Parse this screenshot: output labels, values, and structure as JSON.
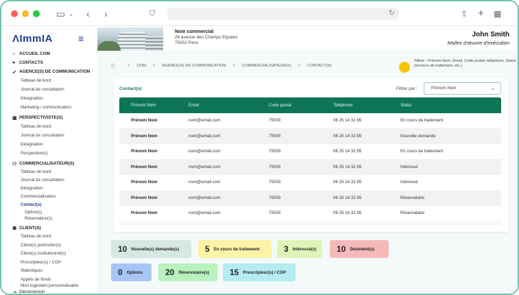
{
  "sidebar": {
    "logo": "ImmIA",
    "sections": [
      {
        "label": "ACCUEIL COM",
        "icon": "home-icon",
        "items": []
      },
      {
        "label": "CONTACTS",
        "icon": "user-icon",
        "items": []
      },
      {
        "label": "AGENCE(S) DE COMMUNICATION",
        "icon": "rocket-icon",
        "items": [
          "Tableau de bord",
          "Journal de consultation",
          "Désignation",
          "Marketing / communication"
        ]
      },
      {
        "label": "PERSPECTIVISTE(S)",
        "icon": "id-card-icon",
        "items": [
          "Tableau de bord",
          "Journal de consultation",
          "Désignation",
          "Perspective(s)"
        ]
      },
      {
        "label": "COMMERCIALISATEUR(S)",
        "icon": "users-icon",
        "items": [
          "Tableau de bord",
          "Journal de consultation",
          "Désignation",
          "Commercialisation",
          "Contact(s)",
          "Option(s)",
          "Réservation(s)"
        ]
      },
      {
        "label": "CLIENT(S)",
        "icon": "clients-icon",
        "items": [
          "Tableau de bord",
          "Client(s) particulier(s)",
          "Client(s) institutionnel(s)",
          "Prescripteur(s) / CGP",
          "Statistiques",
          "Appels de fonds",
          "Mon logement personnalisable"
        ]
      }
    ],
    "logout": "Déconnexion"
  },
  "header": {
    "company_name": "Nom commercial",
    "address_line1": "26 avenue des Champs Elysées",
    "address_line2": "75002 Paris",
    "user_name": "John Smith",
    "user_role": "Maître d'œuvre d'exécution"
  },
  "breadcrumb": [
    "COM",
    "AGENCE(S) DE COMMUNICATION",
    "COMMERCIALISATEUR(S)",
    "CONTACT(S)"
  ],
  "filters_info": "Filtres : Prénom Nom, Email, Code postal, téléphone, Statut (encours de traitement, etc.)",
  "contacts": {
    "title": "Contact(s)",
    "filter_label": "Filtrer par :",
    "filter_value": "Prénom Nom",
    "columns": [
      "Prénom Nom",
      "Email",
      "Code postal",
      "Telephone",
      "Statut"
    ],
    "rows": [
      [
        "Prénom Nom",
        "nom@email.com",
        "75000",
        "06 25 14 32 85",
        "En cours de traitement"
      ],
      [
        "Prénom Nom",
        "nom@email.com",
        "75000",
        "06 25 14 32 85",
        "Nouvelle demande"
      ],
      [
        "Prénom Nom",
        "nom@email.com",
        "75000",
        "06 25 14 32 85",
        "En cours de traitement"
      ],
      [
        "Prénom Nom",
        "nom@email.com",
        "75000",
        "06 25 14 32 85",
        "Intéressé"
      ],
      [
        "Prénom Nom",
        "nom@email.com",
        "75000",
        "06 25 14 32 85",
        "Intéressé"
      ],
      [
        "Prénom Nom",
        "nom@email.com",
        "75000",
        "06 25 14 32 85",
        "Réservataire"
      ],
      [
        "Prénom Nom",
        "nom@email.com",
        "75000",
        "06 25 14 32 85",
        "Réservataire"
      ]
    ]
  },
  "stats": [
    {
      "count": "10",
      "label": "Nouvelle(s) demande(s)",
      "color": "#d6e8e4"
    },
    {
      "count": "5",
      "label": "En cours de traitement",
      "color": "#fbf3a6"
    },
    {
      "count": "3",
      "label": "Intéressé(s)",
      "color": "#e1f4b8"
    },
    {
      "count": "10",
      "label": "Désintéré(s)",
      "color": "#f6b9b9"
    },
    {
      "count": "0",
      "label": "Options",
      "color": "#a9c5f6"
    },
    {
      "count": "20",
      "label": "Réservataire(s)",
      "color": "#b9f1bf"
    },
    {
      "count": "15",
      "label": "Prescripteur(s) / CGP",
      "color": "#b4ecef"
    }
  ],
  "colors": {
    "brand": "#1f3d9e",
    "accent": "#0d7556",
    "frame": "#6fc2ab",
    "highlight": "#f7c600"
  }
}
